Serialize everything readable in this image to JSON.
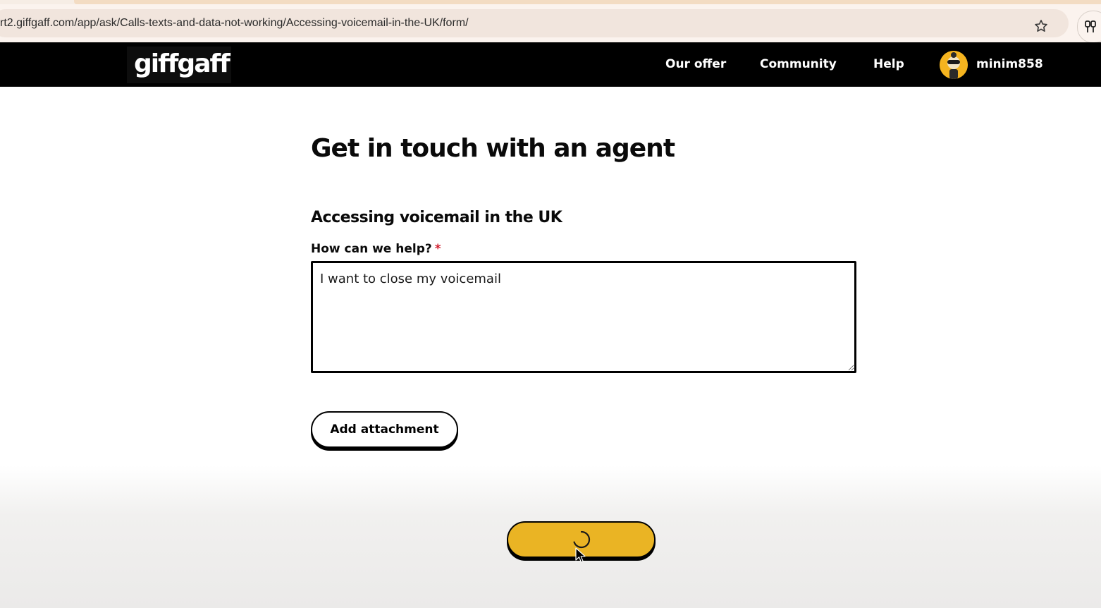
{
  "browser": {
    "url": "rt2.giffgaff.com/app/ask/Calls-texts-and-data-not-working/Accessing-voicemail-in-the-UK/form/",
    "bookmark_icon": "star-icon",
    "extension_icon": "extension-icon"
  },
  "header": {
    "logo": "giffgaff",
    "nav": {
      "offer": "Our offer",
      "community": "Community",
      "help": "Help"
    },
    "user": {
      "name": "minim858",
      "avatar_icon": "user-avatar"
    }
  },
  "main": {
    "title": "Get in touch with an agent",
    "section_title": "Accessing voicemail in the UK",
    "form": {
      "label": "How can we help?",
      "required_mark": "*",
      "value": "I want to close my voicemail"
    },
    "attach_label": "Add attachment"
  },
  "submit": {
    "state": "loading",
    "icon": "spinner-icon"
  },
  "colors": {
    "brand_black": "#000000",
    "accent_yellow": "#eab424",
    "required_red": "#d11a2a",
    "avatar_yellow": "#f5b41f"
  }
}
